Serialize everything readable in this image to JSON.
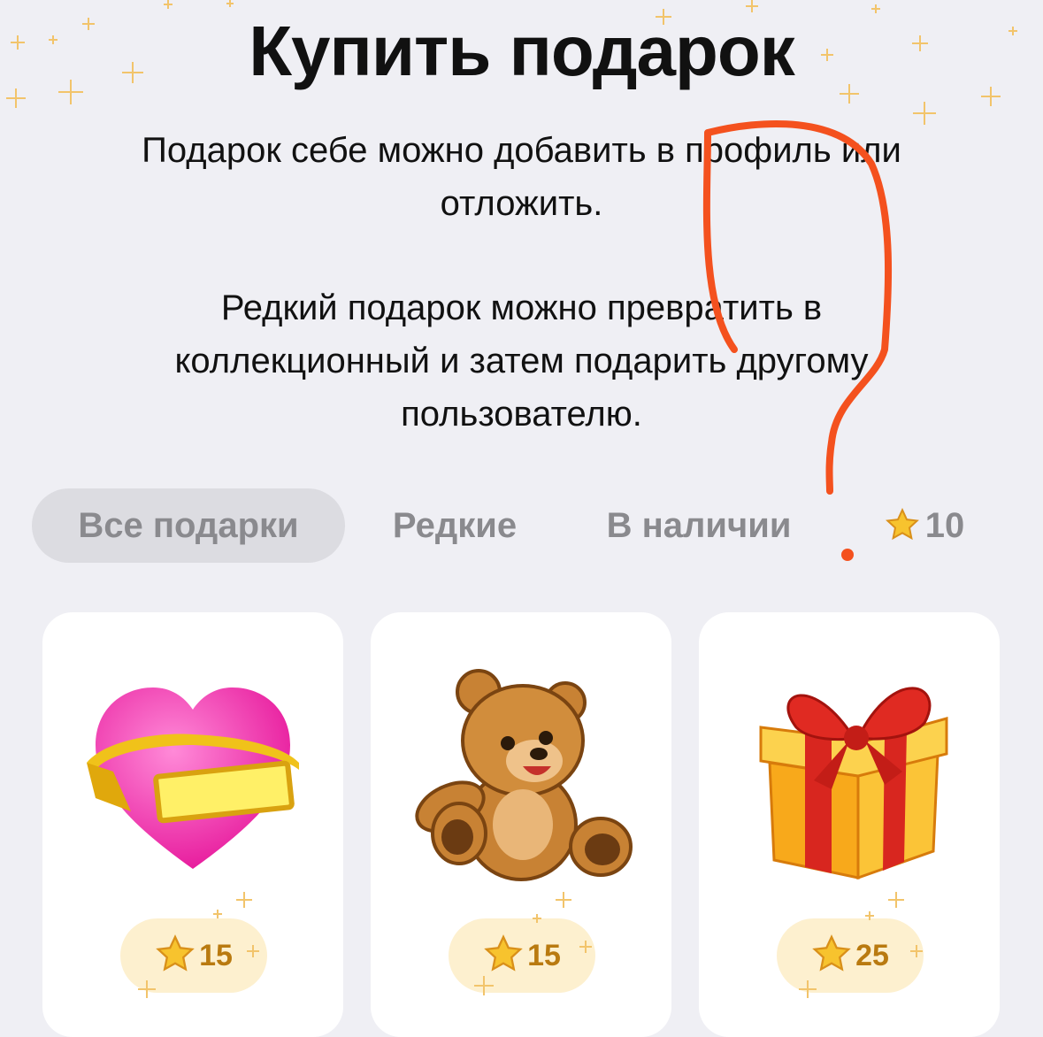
{
  "page": {
    "title": "Купить подарок",
    "description_1": "Подарок себе можно добавить в профиль или отложить.",
    "description_2": "Редкий подарок можно превратить в коллекционный и затем подарить другому пользователю."
  },
  "filters": {
    "items": [
      {
        "label": "Все подарки",
        "active": true
      },
      {
        "label": "Редкие",
        "active": false
      },
      {
        "label": "В наличии",
        "active": false
      }
    ],
    "star_filter": {
      "icon": "star-icon",
      "value": "10"
    }
  },
  "gifts": [
    {
      "icon": "heart-icon",
      "price": "15"
    },
    {
      "icon": "teddy-bear-icon",
      "price": "15"
    },
    {
      "icon": "gift-box-icon",
      "price": "25"
    }
  ],
  "colors": {
    "background": "#efeff4",
    "chip_active": "#dcdce1",
    "price_badge": "#fdf0cf",
    "price_text": "#b97a10",
    "annotation": "#f4511e"
  }
}
